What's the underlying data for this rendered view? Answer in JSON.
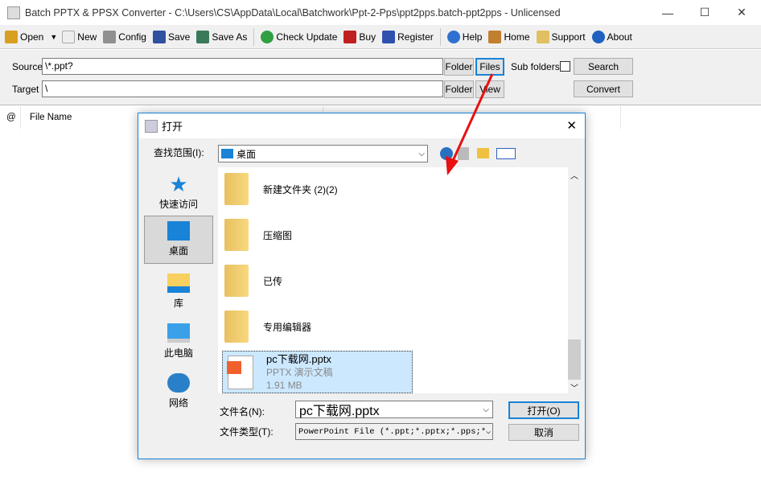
{
  "window": {
    "title": "Batch PPTX & PPSX Converter - C:\\Users\\CS\\AppData\\Local\\Batchwork\\Ppt-2-Pps\\ppt2pps.batch-ppt2pps - Unlicensed",
    "minimize": "—",
    "maximize": "☐",
    "close": "✕"
  },
  "toolbar": {
    "items": [
      {
        "label": "Open",
        "icon": "open-folder-icon",
        "color": "#d8a020"
      },
      {
        "label": "New",
        "icon": "new-file-icon",
        "color": "#e8e8c0"
      },
      {
        "label": "Config",
        "icon": "tools-icon",
        "color": "#909090"
      },
      {
        "label": "Save",
        "icon": "save-icon",
        "color": "#3050a0"
      },
      {
        "label": "Save As",
        "icon": "save-as-icon",
        "color": "#3a7a5a"
      },
      {
        "label": "Check Update",
        "icon": "refresh-icon",
        "color": "#30a040"
      },
      {
        "label": "Buy",
        "icon": "cart-icon",
        "color": "#c02020"
      },
      {
        "label": "Register",
        "icon": "register-icon",
        "color": "#3050b0"
      },
      {
        "label": "Help",
        "icon": "help-icon",
        "color": "#3070d0"
      },
      {
        "label": "Home",
        "icon": "home-icon",
        "color": "#c08030"
      },
      {
        "label": "Support",
        "icon": "support-icon",
        "color": "#e0c060"
      },
      {
        "label": "About",
        "icon": "info-icon",
        "color": "#2060c0"
      }
    ],
    "dropdown": "▼"
  },
  "form": {
    "source_label": "Source",
    "source_value": "\\*.ppt?",
    "target_label": "Target",
    "target_value": "\\",
    "folder": "Folder",
    "files": "Files",
    "view": "View",
    "subfolders": "Sub folders",
    "search": "Search",
    "convert": "Convert"
  },
  "list": {
    "columns": [
      "@",
      "File Name"
    ]
  },
  "dialog": {
    "title": "打开",
    "close": "✕",
    "lookin_label": "查找范围(I):",
    "lookin_value": "桌面",
    "places": [
      "快速访问",
      "桌面",
      "库",
      "此电脑",
      "网络"
    ],
    "files": [
      {
        "name": "新建文件夹 (2)(2)"
      },
      {
        "name": "压缩图"
      },
      {
        "name": "已传"
      },
      {
        "name": "专用编辑器"
      }
    ],
    "selected": {
      "name": "pc下载网.pptx",
      "type": "PPTX 演示文稿",
      "size": "1.91 MB"
    },
    "filename_label": "文件名(N):",
    "filename_value": "pc下载网.pptx",
    "filetype_label": "文件类型(T):",
    "filetype_value": "PowerPoint File (*.ppt;*.pptx;*.pps;*",
    "open": "打开(O)",
    "cancel": "取消"
  },
  "colors": {
    "accent": "#1883d7",
    "selection": "#cce8ff",
    "annotation_arrow": "#e81010"
  }
}
